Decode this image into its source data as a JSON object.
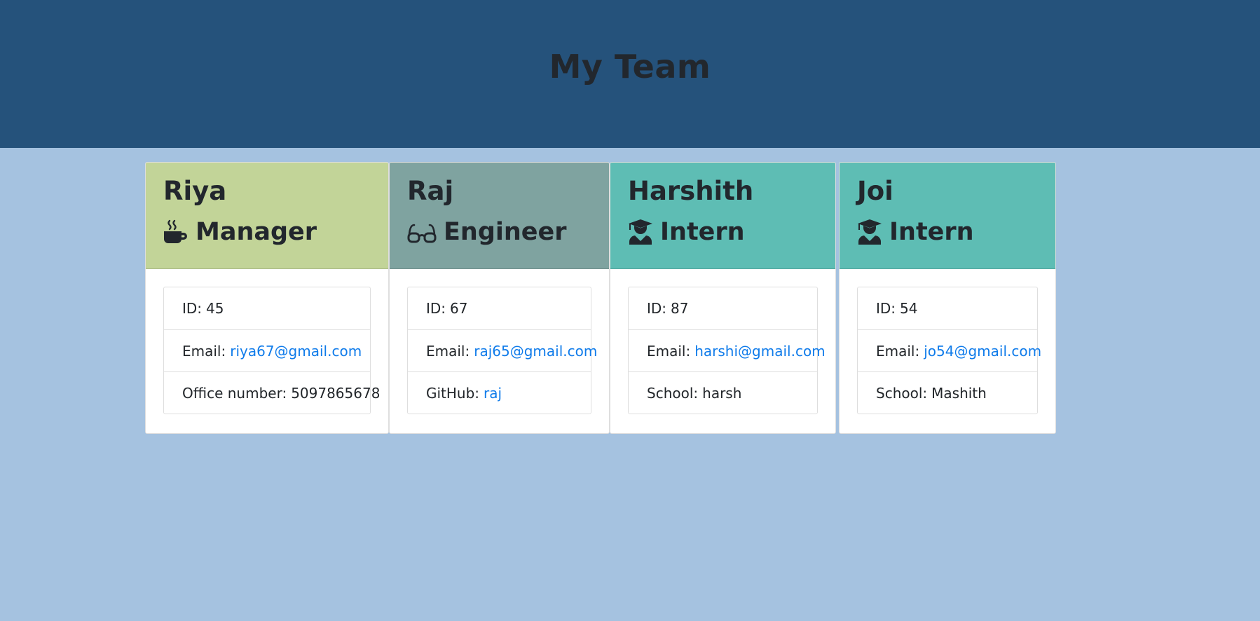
{
  "header": {
    "title": "My Team"
  },
  "colors": {
    "header_bg": "#25527b",
    "page_bg": "#a5c2e0",
    "manager_header": "#c2d498",
    "engineer_header": "#7fa3a0",
    "intern_header": "#5ebdb4",
    "link": "#0f7bea"
  },
  "cards": [
    {
      "name": "Riya",
      "role": "Manager",
      "icon": "mug-hot-icon",
      "id_label": "ID:",
      "id": "45",
      "email_label": "Email:",
      "email": "riya67@gmail.com",
      "extra_label": "Office number:",
      "extra_value": "5097865678"
    },
    {
      "name": "Raj",
      "role": "Engineer",
      "icon": "glasses-icon",
      "id_label": "ID:",
      "id": "67",
      "email_label": "Email:",
      "email": "raj65@gmail.com",
      "extra_label": "GitHub:",
      "extra_value": "raj"
    },
    {
      "name": "Harshith",
      "role": "Intern",
      "icon": "user-graduate-icon",
      "id_label": "ID:",
      "id": "87",
      "email_label": "Email:",
      "email": "harshi@gmail.com",
      "extra_label": "School:",
      "extra_value": "harsh"
    },
    {
      "name": "Joi",
      "role": "Intern",
      "icon": "user-graduate-icon",
      "id_label": "ID:",
      "id": "54",
      "email_label": "Email:",
      "email": "jo54@gmail.com",
      "extra_label": "School:",
      "extra_value": "Mashith"
    }
  ]
}
